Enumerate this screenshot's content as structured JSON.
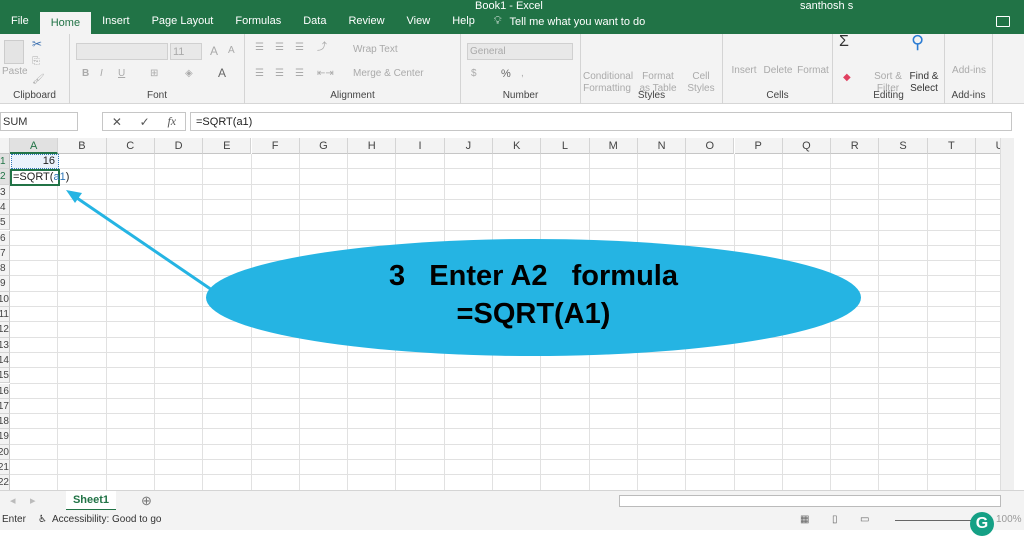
{
  "app": {
    "title": "Book1 - Excel",
    "user": "santhosh s"
  },
  "ribbon_tabs": [
    "File",
    "Home",
    "Insert",
    "Page Layout",
    "Formulas",
    "Data",
    "Review",
    "View",
    "Help"
  ],
  "active_tab": "Home",
  "tell_me": "Tell me what you want to do",
  "ribbon": {
    "clipboard": {
      "label": "Clipboard",
      "paste": "Paste"
    },
    "font": {
      "label": "Font",
      "size": "11",
      "bold": "B",
      "italic": "I",
      "underline": "U"
    },
    "alignment": {
      "label": "Alignment",
      "wrap": "Wrap Text",
      "merge": "Merge & Center"
    },
    "number": {
      "label": "Number",
      "format": "General",
      "percent": "%",
      "comma": ","
    },
    "styles": {
      "label": "Styles",
      "conditional": "Conditional Formatting",
      "format_table": "Format as Table",
      "cell_styles": "Cell Styles"
    },
    "cells": {
      "label": "Cells",
      "insert": "Insert",
      "delete": "Delete",
      "format": "Format"
    },
    "editing": {
      "label": "Editing",
      "sort": "Sort & Filter",
      "find": "Find & Select"
    },
    "addins": {
      "label": "Add-ins",
      "addins": "Add-ins"
    }
  },
  "formula_bar": {
    "name_box": "SUM",
    "cancel": "✕",
    "enter": "✓",
    "fx": "fx",
    "formula": "=SQRT(a1)"
  },
  "columns": [
    "A",
    "B",
    "C",
    "D",
    "E",
    "F",
    "G",
    "H",
    "I",
    "J",
    "K",
    "L",
    "M",
    "N",
    "O",
    "P",
    "Q",
    "R",
    "S",
    "T",
    "U"
  ],
  "rows": [
    "1",
    "2",
    "3",
    "4",
    "5",
    "6",
    "7",
    "8",
    "9",
    "10",
    "11",
    "12",
    "13",
    "14",
    "15",
    "16",
    "17",
    "18",
    "19",
    "20",
    "21",
    "22"
  ],
  "cells": {
    "A1": "16",
    "A2_prefix": "=SQRT(",
    "A2_ref": "a1",
    "A2_suffix": ")"
  },
  "sheets": [
    "Sheet1"
  ],
  "status": {
    "mode": "Enter",
    "accessibility": "Accessibility: Good to go",
    "zoom": "100%"
  },
  "callout": {
    "line1": "3   Enter A2   formula",
    "line2": "=SQRT(A1)"
  },
  "colors": {
    "excel_green": "#217346",
    "callout": "#25b4e3",
    "ref_blue": "#2e75b6"
  }
}
